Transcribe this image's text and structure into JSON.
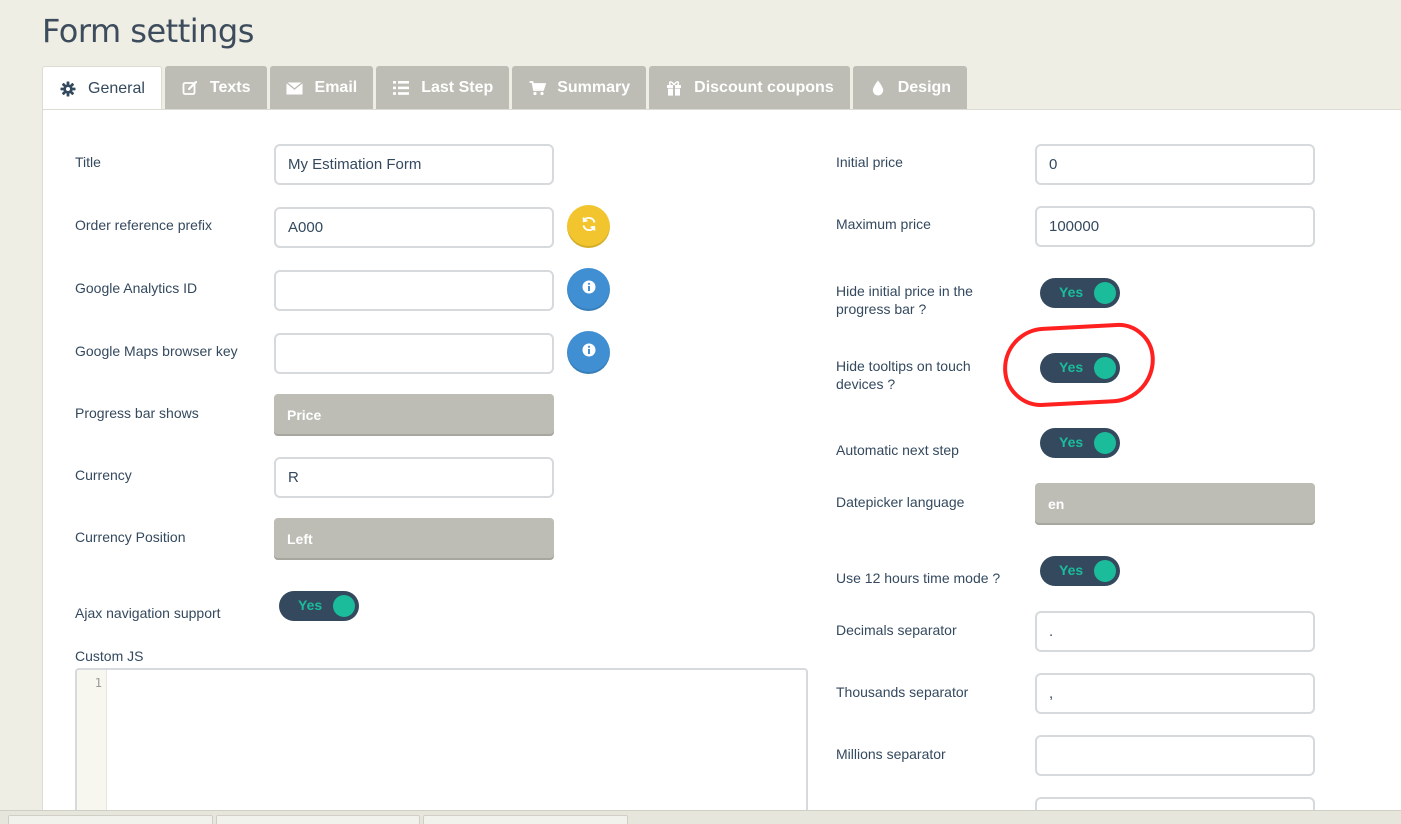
{
  "page": {
    "title": "Form settings"
  },
  "tabs": [
    {
      "label": "General",
      "icon": "gear-icon",
      "active": true
    },
    {
      "label": "Texts",
      "icon": "edit-icon"
    },
    {
      "label": "Email",
      "icon": "envelope-icon"
    },
    {
      "label": "Last Step",
      "icon": "list-icon"
    },
    {
      "label": "Summary",
      "icon": "cart-icon"
    },
    {
      "label": "Discount coupons",
      "icon": "gift-icon"
    },
    {
      "label": "Design",
      "icon": "droplet-icon"
    }
  ],
  "left": {
    "title": {
      "label": "Title",
      "value": "My Estimation Form"
    },
    "order_prefix": {
      "label": "Order reference prefix",
      "value": "A000"
    },
    "ga_id": {
      "label": "Google Analytics ID",
      "value": ""
    },
    "maps_key": {
      "label": "Google Maps browser key",
      "value": ""
    },
    "progress_bar": {
      "label": "Progress bar shows",
      "value": "Price"
    },
    "currency": {
      "label": "Currency",
      "value": "R"
    },
    "currency_position": {
      "label": "Currency Position",
      "value": "Left"
    },
    "ajax_nav": {
      "label": "Ajax navigation support",
      "toggle": "Yes"
    },
    "custom_js": {
      "label": "Custom JS",
      "line": "1"
    }
  },
  "right": {
    "initial_price": {
      "label": "Initial price",
      "value": "0"
    },
    "max_price": {
      "label": "Maximum price",
      "value": "100000"
    },
    "hide_initial_price": {
      "label1": "Hide initial price in the",
      "label2": "progress bar ?",
      "toggle": "Yes"
    },
    "hide_tooltips": {
      "label1": "Hide tooltips on touch",
      "label2": "devices ?",
      "toggle": "Yes"
    },
    "auto_next": {
      "label": "Automatic next step",
      "toggle": "Yes"
    },
    "datepicker_lang": {
      "label": "Datepicker language",
      "value": "en"
    },
    "time_12h": {
      "label": "Use 12 hours time mode ?",
      "toggle": "Yes"
    },
    "decimals_sep": {
      "label": "Decimals separator",
      "value": "."
    },
    "thousands_sep": {
      "label": "Thousands separator",
      "value": ","
    },
    "millions_sep": {
      "label": "Millions separator",
      "value": ""
    }
  },
  "colors": {
    "background": "#efeee4",
    "tab_inactive": "#bdbdb5",
    "toggle_bg": "#34495e",
    "toggle_on": "#1abc9c",
    "yellow_button": "#f2c52e",
    "blue_button": "#3f8fd2",
    "annotation": "#ff2020"
  }
}
